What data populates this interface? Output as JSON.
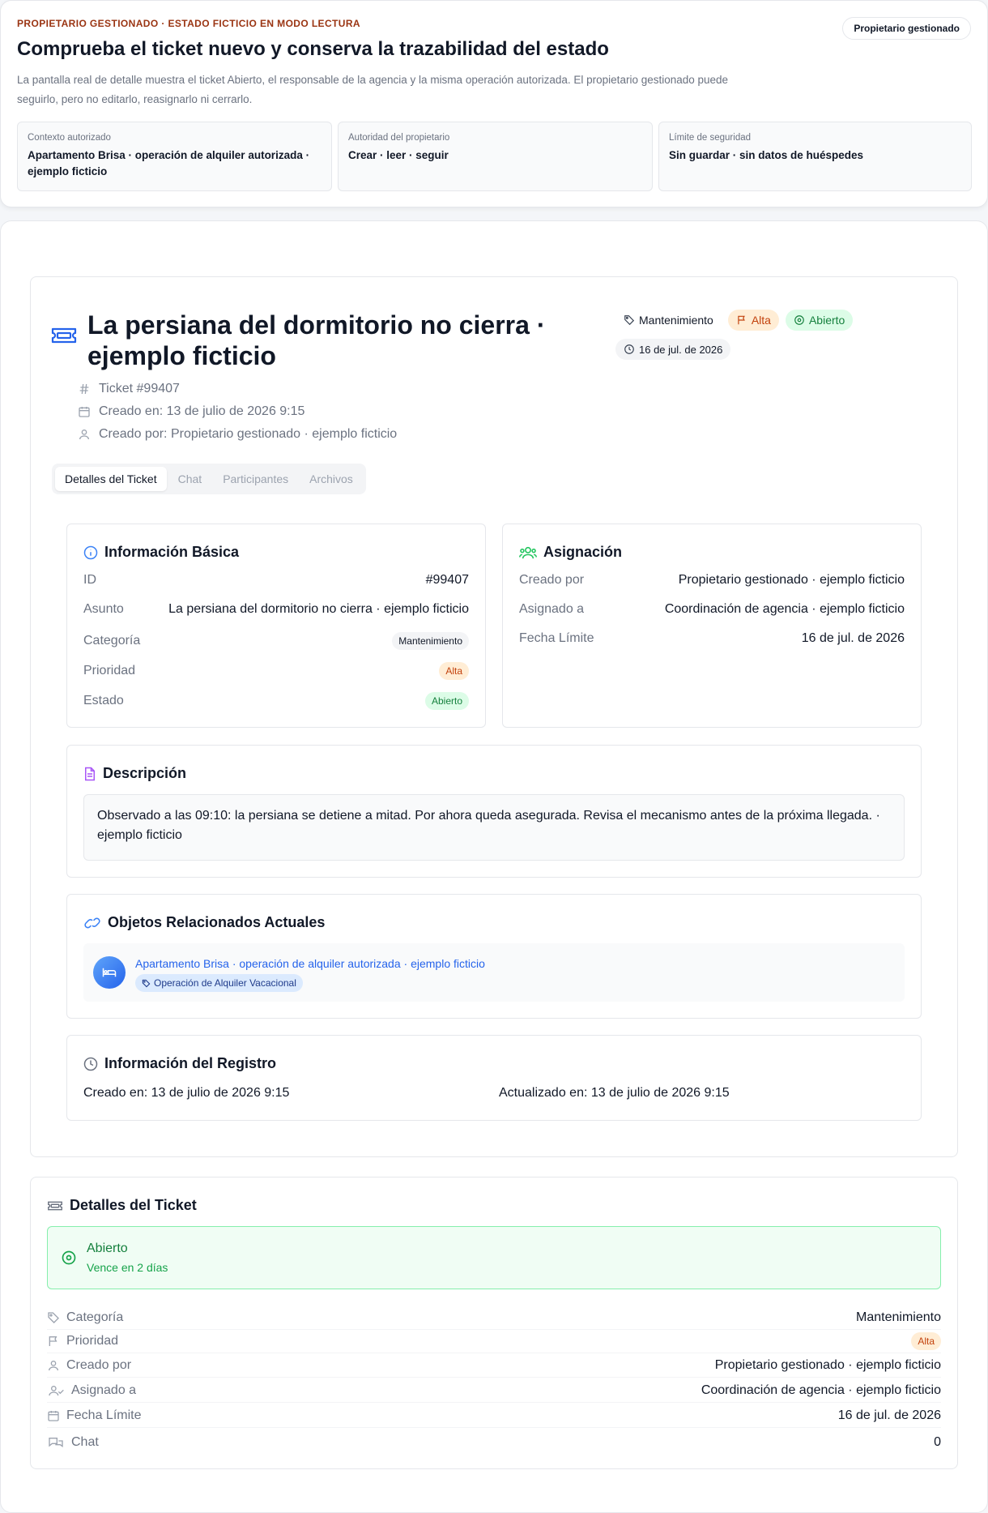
{
  "banner": {
    "eyebrow": "PROPIETARIO GESTIONADO · ESTADO FICTICIO EN MODO LECTURA",
    "owner_pill": "Propietario gestionado",
    "title": "Comprueba el ticket nuevo y conserva la trazabilidad del estado",
    "description": "La pantalla real de detalle muestra el ticket Abierto, el responsable de la agencia y la misma operación autorizada. El propietario gestionado puede seguirlo, pero no editarlo, reasignarlo ni cerrarlo.",
    "cards": [
      {
        "label": "Contexto autorizado",
        "value": "Apartamento Brisa · operación de alquiler autorizada · ejemplo ficticio"
      },
      {
        "label": "Autoridad del propietario",
        "value": "Crear · leer · seguir"
      },
      {
        "label": "Límite de seguridad",
        "value": "Sin guardar · sin datos de huéspedes"
      }
    ]
  },
  "ticket": {
    "title": "La persiana del dormitorio no cierra · ejemplo ficticio",
    "badges": {
      "category": "Mantenimiento",
      "priority": "Alta",
      "status": "Abierto",
      "due": "16 de jul. de 2026"
    },
    "meta": {
      "number": "Ticket #99407",
      "created_at": "Creado en: 13 de julio de 2026 9:15",
      "created_by": "Creado por: Propietario gestionado · ejemplo ficticio"
    },
    "tabs": [
      "Detalles del Ticket",
      "Chat",
      "Participantes",
      "Archivos"
    ]
  },
  "basic_info": {
    "heading": "Información Básica",
    "rows": [
      {
        "k": "ID",
        "v": "#99407"
      },
      {
        "k": "Asunto",
        "v": "La persiana del dormitorio no cierra · ejemplo ficticio"
      },
      {
        "k": "Categoría",
        "v": "Mantenimiento"
      },
      {
        "k": "Prioridad",
        "v": "Alta"
      },
      {
        "k": "Estado",
        "v": "Abierto"
      }
    ]
  },
  "assignment": {
    "heading": "Asignación",
    "rows": [
      {
        "k": "Creado por",
        "v": "Propietario gestionado · ejemplo ficticio"
      },
      {
        "k": "Asignado a",
        "v": "Coordinación de agencia · ejemplo ficticio"
      },
      {
        "k": "Fecha Límite",
        "v": "16 de jul. de 2026"
      }
    ]
  },
  "description": {
    "heading": "Descripción",
    "text": "Observado a las 09:10: la persiana se detiene a mitad. Por ahora queda asegurada. Revisa el mecanismo antes de la próxima llegada. · ejemplo ficticio"
  },
  "related": {
    "heading": "Objetos Relacionados Actuales",
    "item_link": "Apartamento Brisa · operación de alquiler autorizada · ejemplo ficticio",
    "item_tag": "Operación de Alquiler Vacacional"
  },
  "record": {
    "heading": "Información del Registro",
    "created": "Creado en: 13 de julio de 2026 9:15",
    "updated": "Actualizado en: 13 de julio de 2026 9:15"
  },
  "details": {
    "heading": "Detalles del Ticket",
    "status_title": "Abierto",
    "status_sub": "Vence en 2 días",
    "rows": [
      {
        "k": "Categoría",
        "v": "Mantenimiento"
      },
      {
        "k": "Prioridad",
        "v": "Alta"
      },
      {
        "k": "Creado por",
        "v": "Propietario gestionado · ejemplo ficticio"
      },
      {
        "k": "Asignado a",
        "v": "Coordinación de agencia · ejemplo ficticio"
      },
      {
        "k": "Fecha Límite",
        "v": "16 de jul. de 2026"
      },
      {
        "k": "Chat",
        "v": "0"
      }
    ]
  },
  "colors": {
    "accent": "#2563eb",
    "eyebrow": "#9a3412",
    "priority_bg": "#ffedd5",
    "priority_fg": "#c2410c",
    "status_bg": "#dcfce7",
    "status_fg": "#15803d"
  },
  "icons": {
    "ticket": "ticket-icon",
    "tag": "tag-icon",
    "flag": "flag-icon",
    "status": "circle-dot-icon",
    "clock": "clock-icon",
    "hash": "hash-icon",
    "calendar": "calendar-icon",
    "user": "user-icon",
    "info": "info-icon",
    "users": "users-icon",
    "file": "file-text-icon",
    "link": "link-icon",
    "bed": "bed-icon",
    "user_check": "user-check-icon",
    "chat": "chat-icon"
  }
}
